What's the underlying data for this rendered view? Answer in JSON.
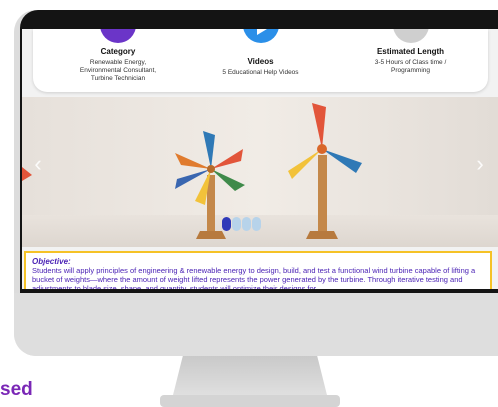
{
  "info": {
    "category": {
      "title": "Category",
      "lines": [
        "Renewable Energy,",
        "Environmental Consultant,",
        "Turbine Technician"
      ],
      "color": "#6b35c8"
    },
    "videos": {
      "title": "Videos",
      "text": "5 Educational Help Videos",
      "color": "#2b8fe8"
    },
    "length": {
      "title": "Estimated Length",
      "lines": [
        "3-5 Hours of Class time /",
        "Programming"
      ],
      "color": "#cfcfcf"
    }
  },
  "carousel": {
    "prev_icon": "chevron-left-icon",
    "next_icon": "chevron-right-icon",
    "prev_glyph": "‹",
    "next_glyph": "›",
    "slide_count": 4,
    "active_slide": 1
  },
  "objective": {
    "label": "Objective:",
    "text": "Students will apply principles of engineering & renewable energy to design, build, and test a functional wind turbine capable of lifting a bucket of weights—where the amount of weight lifted represents the power generated by the turbine. Through iterative testing and adjustments to blade size, shape, and quantity, students will optimize their designs for"
  },
  "bottom_text": "sed",
  "colors": {
    "accent_purple": "#4b23b5",
    "highlight_yellow": "#f5c226",
    "dot_active": "#2f39b8",
    "dot_inactive": "#b7d3ea"
  }
}
